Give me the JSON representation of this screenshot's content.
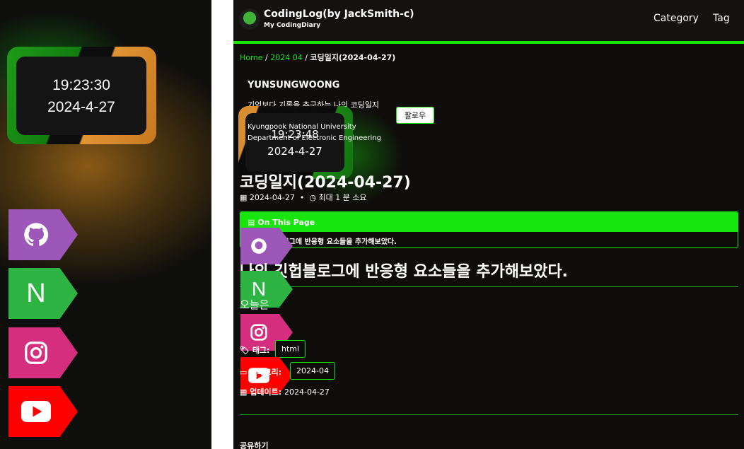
{
  "left_panel": {
    "clock": {
      "time": "19:23:30",
      "date": "2024-4-27"
    },
    "social": [
      {
        "name": "github",
        "icon": "github-icon",
        "color": "#9c57b8"
      },
      {
        "name": "naver",
        "icon": "naver-icon",
        "label": "N",
        "color": "#2db443"
      },
      {
        "name": "instagram",
        "icon": "instagram-icon",
        "color": "#d62e7f"
      },
      {
        "name": "youtube",
        "icon": "youtube-icon",
        "color": "#ff0000"
      }
    ]
  },
  "header": {
    "title": "CodingLog(by JackSmith-c)",
    "subtitle": "My CodingDiary",
    "nav": [
      "Category",
      "Tag"
    ]
  },
  "breadcrumb": {
    "home": "Home",
    "sep": "/",
    "month": "2024 04",
    "current": "코딩일지(2024-04-27)"
  },
  "author": {
    "name": "YUNSUNGWOONG",
    "bio": "기억보다 기록을 추구하는 나의 코딩일지",
    "follow": "팔로우",
    "university": "Kyungpook National University",
    "department": "Department of Electronic Engineering"
  },
  "ghost_clock": {
    "time": "19:23:48",
    "date": "2024-4-27"
  },
  "post": {
    "title": "코딩일지(2024-04-27)",
    "date": "2024-04-27",
    "dot": "•",
    "read_time": "최대 1 분 소요",
    "toc_title": "On This Page",
    "toc_items": [
      "나의 깃헙블로그에 반응형 요소들을 추가해보았다."
    ],
    "h2": "나의 깃헙블로그에 반응형 요소들을 추가해보았다.",
    "paragraph": "오늘은"
  },
  "footer_meta": {
    "tags_label": "태그:",
    "tags": [
      "html"
    ],
    "category_label": "카테고리:",
    "categories": [
      "2024-04"
    ],
    "updated_label": "업데이트:",
    "updated": "2024-04-27",
    "share": "공유하기"
  },
  "colors": {
    "accent": "#17e50b",
    "bg": "#0f0d0b",
    "text": "#ffffff"
  }
}
